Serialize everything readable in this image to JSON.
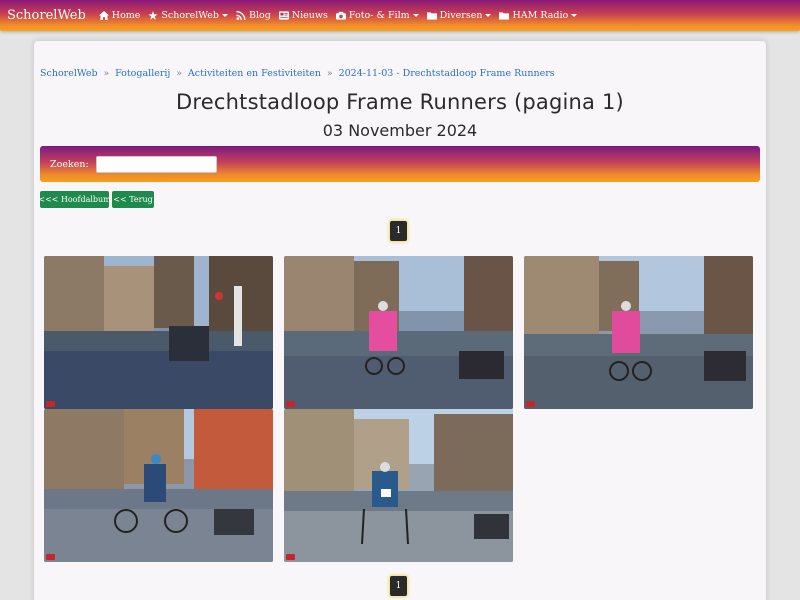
{
  "navbar": {
    "brand": "SchorelWeb",
    "items": [
      {
        "label": "Home",
        "icon": "home-icon",
        "dropdown": false
      },
      {
        "label": "SchorelWeb",
        "icon": "star-icon",
        "dropdown": true
      },
      {
        "label": "Blog",
        "icon": "rss-icon",
        "dropdown": false
      },
      {
        "label": "Nieuws",
        "icon": "newspaper-icon",
        "dropdown": false
      },
      {
        "label": "Foto- & Film",
        "icon": "camera-icon",
        "dropdown": true
      },
      {
        "label": "Diversen",
        "icon": "folder-icon",
        "dropdown": true
      },
      {
        "label": "HAM Radio",
        "icon": "folder-icon",
        "dropdown": true
      }
    ]
  },
  "breadcrumb": {
    "items": [
      "SchorelWeb",
      "Fotogallerij",
      "Activiteiten en Festiviteiten",
      "2024-11-03 - Drechtstadloop Frame Runners"
    ],
    "separator": "»"
  },
  "page": {
    "title": "Drechtstadloop Frame Runners (pagina 1)",
    "date": "03 November 2024"
  },
  "search": {
    "label": "Zoeken:",
    "value": ""
  },
  "buttons": {
    "main_album": "<<< Hoofdalbum",
    "back": "<< Terug"
  },
  "pagination": {
    "top": "1",
    "bottom": "1"
  },
  "gallery": {
    "photo_count": 5
  },
  "colors": {
    "gradient_start": "#8b1a7a",
    "gradient_end": "#f7a21b",
    "link": "#2a6fd6",
    "button": "#1e8a4c"
  }
}
